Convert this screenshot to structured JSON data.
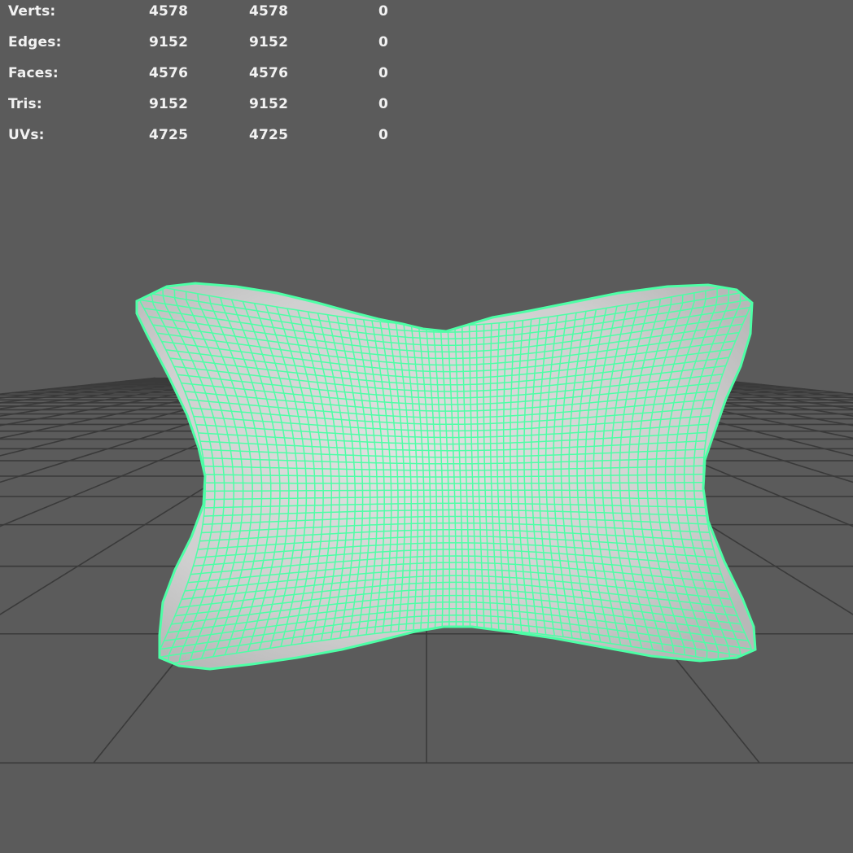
{
  "stats": [
    {
      "label": "Verts:",
      "total": "4578",
      "selected": "4578",
      "extra": "0"
    },
    {
      "label": "Edges:",
      "total": "9152",
      "selected": "9152",
      "extra": "0"
    },
    {
      "label": "Faces:",
      "total": "4576",
      "selected": "4576",
      "extra": "0"
    },
    {
      "label": "Tris:",
      "total": "9152",
      "selected": "9152",
      "extra": "0"
    },
    {
      "label": "UVs:",
      "total": "4725",
      "selected": "4725",
      "extra": "0"
    }
  ],
  "colors": {
    "background": "#5b5b5b",
    "grid": "#3a3a3a",
    "wireframe": "#4dffa6",
    "surface": "#d4d4d4",
    "hud_text": "#f2f2f2"
  }
}
